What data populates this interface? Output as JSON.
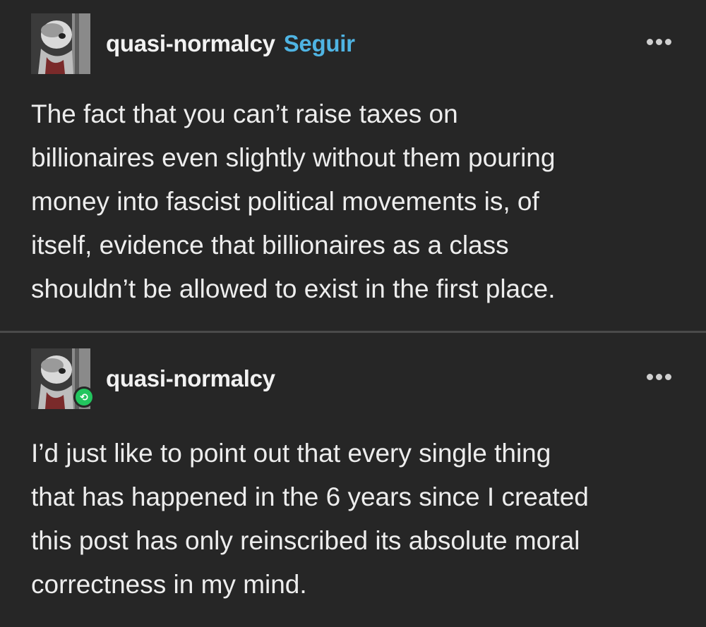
{
  "original_post": {
    "username": "quasi-normalcy",
    "follow_label": "Seguir",
    "more_icon": "ellipsis-horizontal-icon",
    "avatar_icon": "avatar-image",
    "lines": [
      "The fact that you can’t raise taxes on",
      "billionaires even slightly without them pouring",
      "money into fascist political movements is, of",
      "itself, evidence that billionaires as a class",
      "shouldn’t be allowed to exist in the first place."
    ]
  },
  "reblog_post": {
    "username": "quasi-normalcy",
    "more_icon": "ellipsis-horizontal-icon",
    "avatar_icon": "avatar-image",
    "badge_icon": "reblog-icon",
    "badge_color": "#22c55e",
    "lines": [
      "I’d just like to point out that every single thing",
      "that has happened in the 6 years since I created",
      "this post has only reinscribed its absolute moral",
      "correctness in my mind."
    ]
  },
  "colors": {
    "background": "#262626",
    "text": "#ededed",
    "follow_link": "#4fb4e3",
    "divider": "#4a4a4a"
  }
}
